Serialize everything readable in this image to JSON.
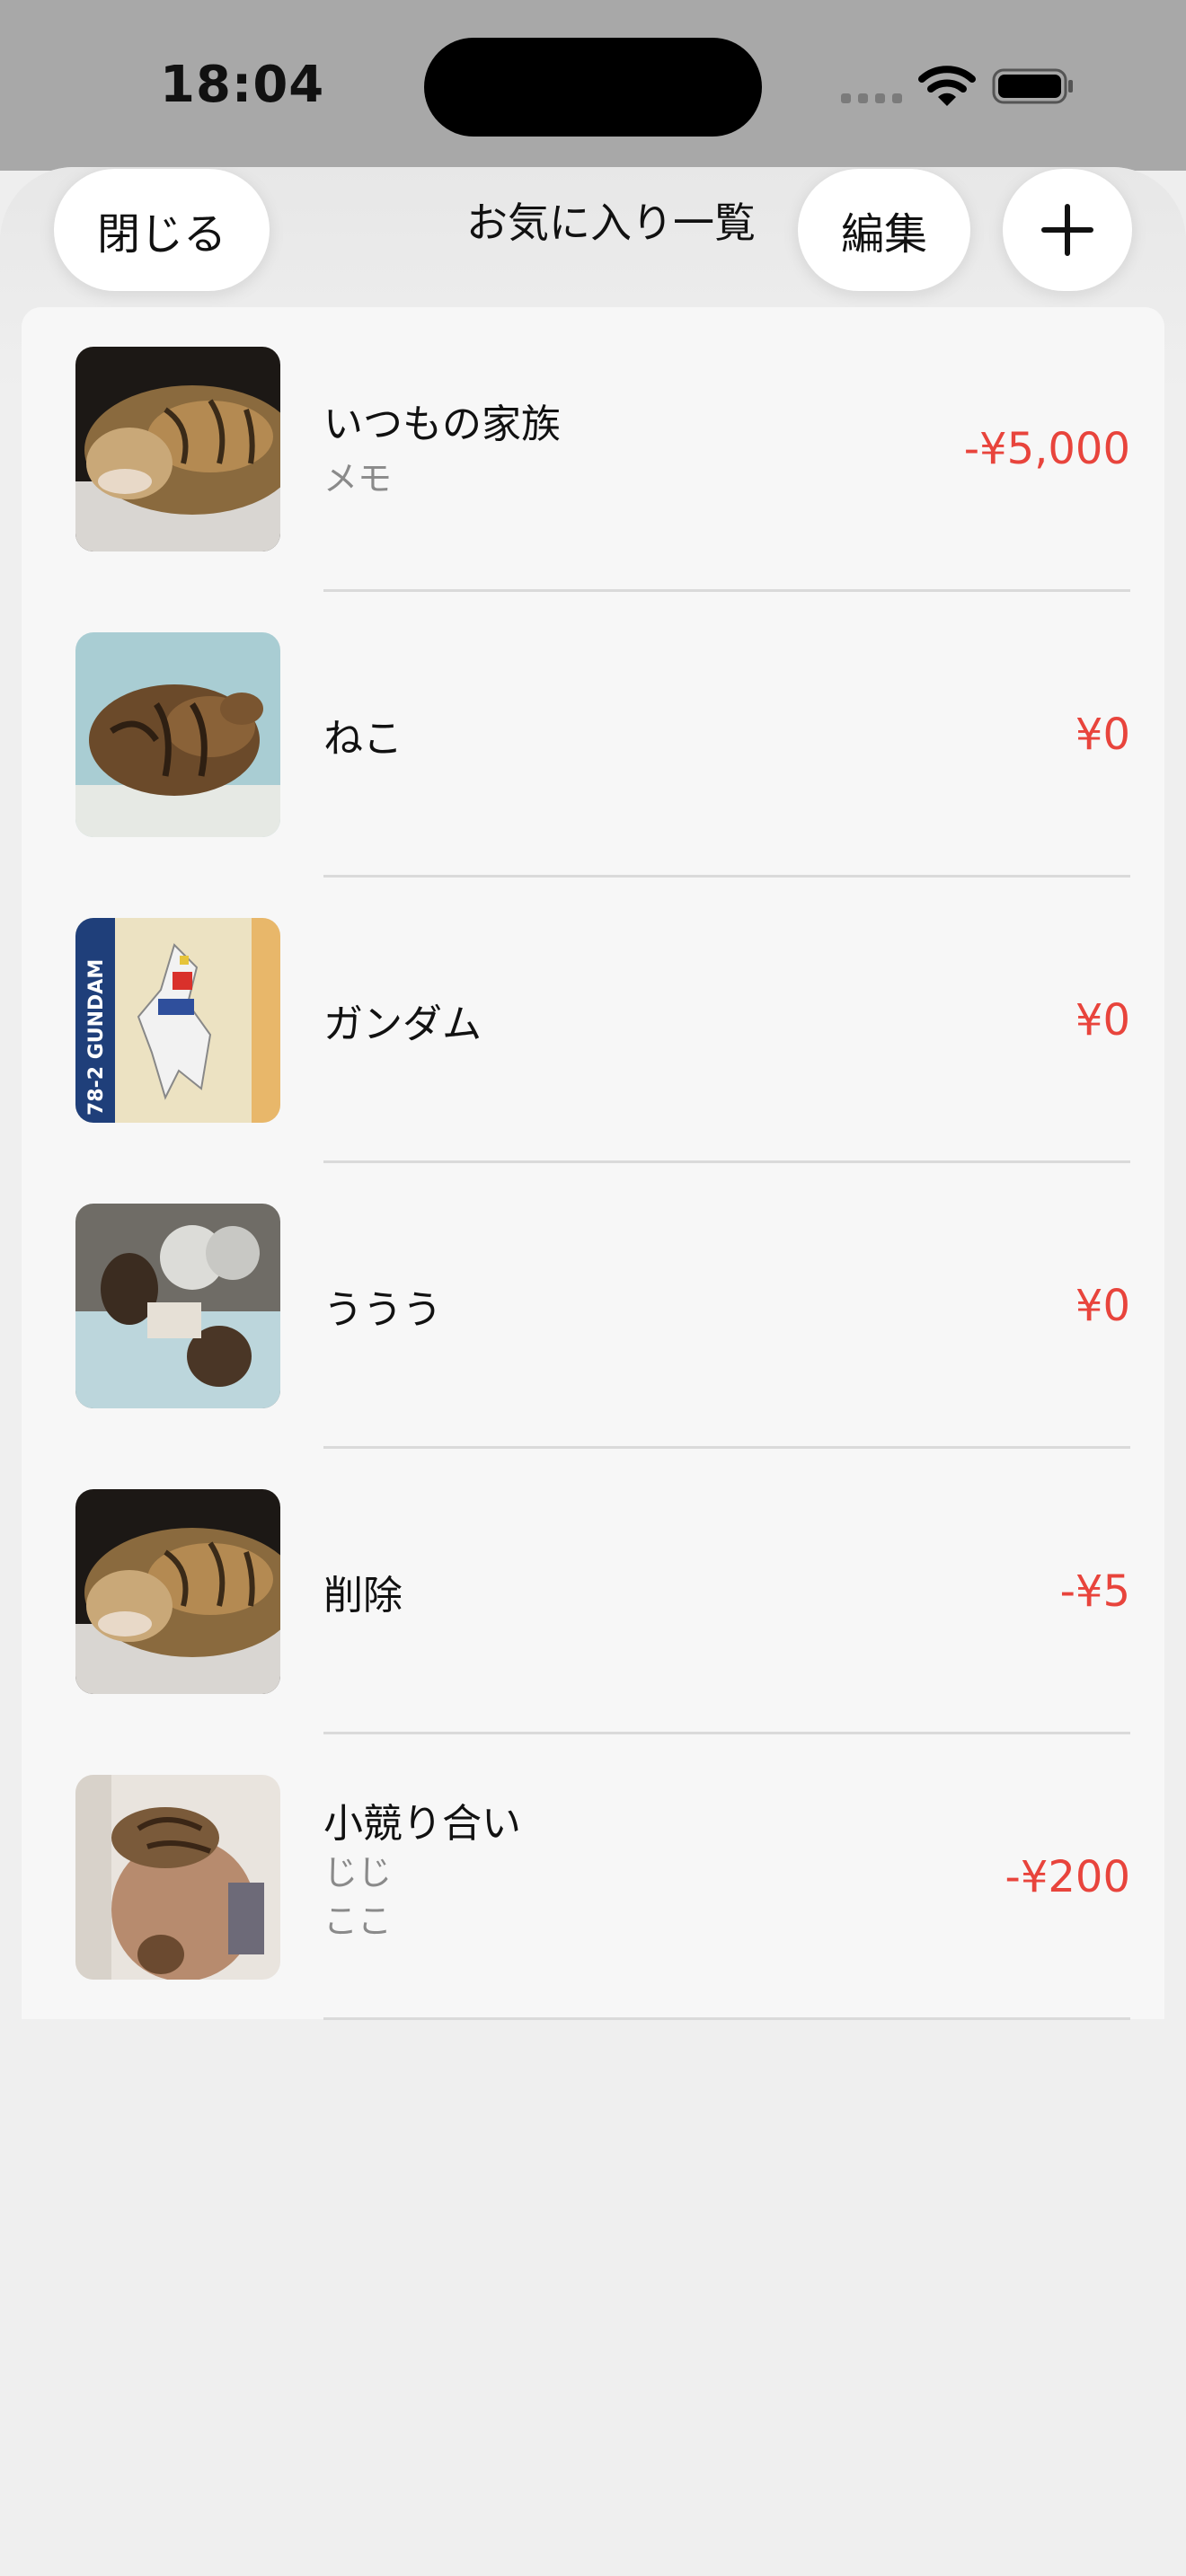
{
  "status_bar": {
    "time": "18:04",
    "icons": [
      "cellular-icon",
      "wifi-icon",
      "battery-icon"
    ]
  },
  "header": {
    "close_label": "閉じる",
    "title": "お気に入り一覧",
    "edit_label": "編集",
    "add_icon": "plus-icon"
  },
  "colors": {
    "amount": "#e8443c",
    "accent": "#000000"
  },
  "items": [
    {
      "title": "いつもの家族",
      "subtitles": [
        "メモ"
      ],
      "amount": "-¥5,000",
      "image": "sleeping-tabby-cat-photo"
    },
    {
      "title": "ねこ",
      "subtitles": [],
      "amount": "¥0",
      "image": "curled-cat-on-blanket-photo"
    },
    {
      "title": "ガンダム",
      "subtitles": [],
      "amount": "¥0",
      "image": "gundam-model-box-photo",
      "image_text": "78-2 GUNDAM"
    },
    {
      "title": "ううう",
      "subtitles": [],
      "amount": "¥0",
      "image": "two-cats-in-room-photo"
    },
    {
      "title": "削除",
      "subtitles": [],
      "amount": "-¥5",
      "image": "sleeping-tabby-cat-photo"
    },
    {
      "title": "小競り合い",
      "subtitles": [
        "じじ",
        "ここ"
      ],
      "amount": "-¥200",
      "image": "cat-on-shoulder-photo"
    }
  ]
}
